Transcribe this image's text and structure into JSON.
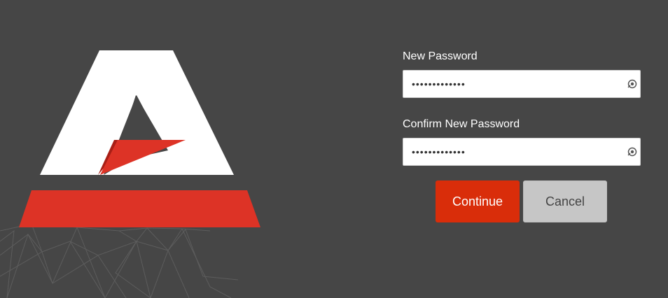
{
  "form": {
    "new_password_label": "New Password",
    "new_password_value": "•••••••••••••",
    "confirm_password_label": "Confirm New Password",
    "confirm_password_value": "•••••••••••••"
  },
  "buttons": {
    "continue_label": "Continue",
    "cancel_label": "Cancel"
  },
  "icons": {
    "password_reveal": "eye-reveal-icon"
  },
  "colors": {
    "background": "#464646",
    "accent_red": "#d92d0a",
    "logo_red": "#dd3326",
    "logo_white": "#ffffff",
    "cancel_gray": "#c6c6c6"
  }
}
